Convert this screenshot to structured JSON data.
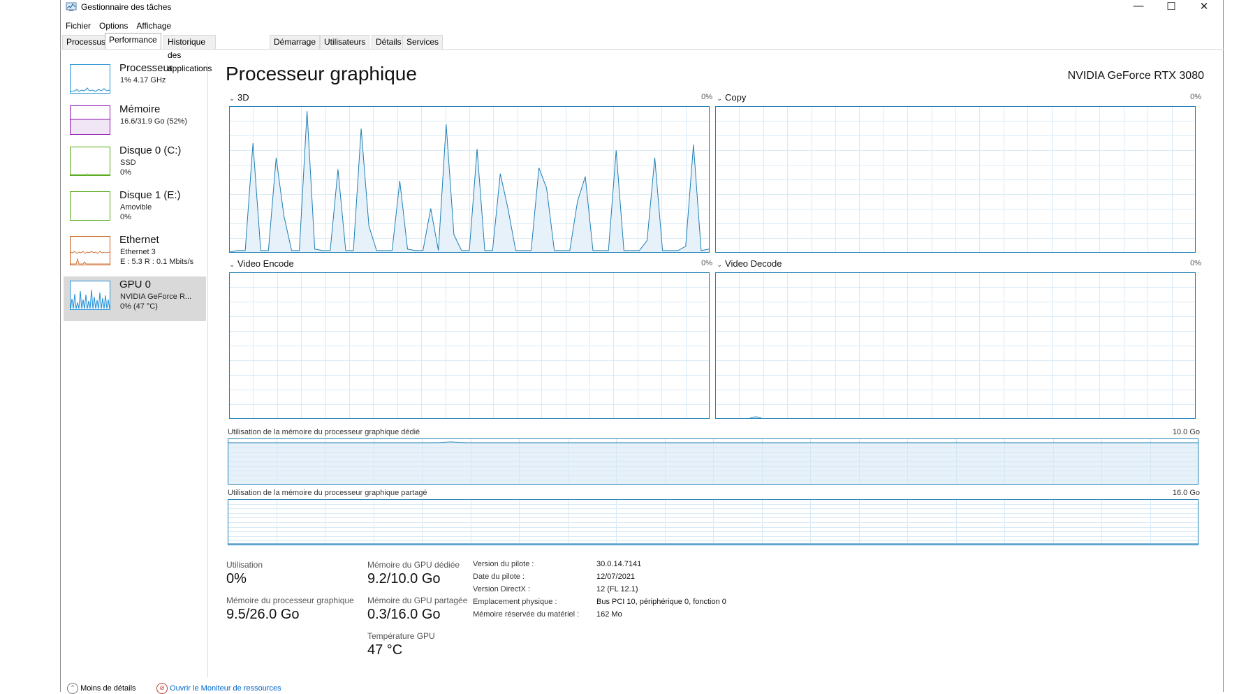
{
  "window": {
    "title": "Gestionnaire des tâches"
  },
  "window_controls": {
    "minimize": "—",
    "maximize": "☐",
    "close": "✕"
  },
  "menu": [
    "Fichier",
    "Options",
    "Affichage"
  ],
  "tabs": [
    "Processus",
    "Performance",
    "Historique des applications",
    "Démarrage",
    "Utilisateurs",
    "Détails",
    "Services"
  ],
  "active_tab": "Performance",
  "sidebar": {
    "items": [
      {
        "name": "Processeur",
        "lines": [
          "1% 4.17 GHz"
        ],
        "color": "#1f8fd6",
        "selected": false
      },
      {
        "name": "Mémoire",
        "lines": [
          "16.6/31.9 Go (52%)"
        ],
        "color": "#8b12ae",
        "selected": false
      },
      {
        "name": "Disque 0 (C:)",
        "lines": [
          "SSD",
          "0%"
        ],
        "color": "#4da60c",
        "selected": false
      },
      {
        "name": "Disque 1 (E:)",
        "lines": [
          "Amovible",
          "0%"
        ],
        "color": "#4da60c",
        "selected": false
      },
      {
        "name": "Ethernet",
        "lines": [
          "Ethernet 3",
          "E : 5.3 R : 0.1 Mbits/s"
        ],
        "color": "#c6570f",
        "selected": false
      },
      {
        "name": "GPU 0",
        "lines": [
          "NVIDIA GeForce R...",
          "0% (47 °C)"
        ],
        "color": "#1f8fd6",
        "selected": true
      }
    ]
  },
  "main": {
    "title": "Processeur graphique",
    "gpu_model": "NVIDIA GeForce RTX 3080",
    "engines": [
      {
        "label": "3D",
        "percent": "0%"
      },
      {
        "label": "Copy",
        "percent": "0%"
      },
      {
        "label": "Video Encode",
        "percent": "0%"
      },
      {
        "label": "Video Decode",
        "percent": "0%"
      }
    ],
    "dedicated_memory": {
      "label": "Utilisation de la mémoire du processeur graphique dédié",
      "max": "10.0 Go"
    },
    "shared_memory": {
      "label": "Utilisation de la mémoire du processeur graphique partagé",
      "max": "16.0 Go"
    }
  },
  "stats": {
    "utilisation": {
      "label": "Utilisation",
      "value": "0%"
    },
    "gpu_memory": {
      "label": "Mémoire du processeur graphique",
      "value": "9.5/26.0 Go"
    },
    "dedicated": {
      "label": "Mémoire du GPU dédiée",
      "value": "9.2/10.0 Go"
    },
    "shared": {
      "label": "Mémoire du GPU partagée",
      "value": "0.3/16.0 Go"
    },
    "temperature": {
      "label": "Température GPU",
      "value": "47 °C"
    }
  },
  "details": [
    {
      "key": "Version du pilote :",
      "value": "30.0.14.7141"
    },
    {
      "key": "Date du pilote :",
      "value": "12/07/2021"
    },
    {
      "key": "Version DirectX :",
      "value": "12 (FL 12.1)"
    },
    {
      "key": "Emplacement physique :",
      "value": "Bus PCI 10, périphérique 0, fonction 0"
    },
    {
      "key": "Mémoire réservée du matériel :",
      "value": "162 Mo"
    }
  ],
  "footer": {
    "less_details": "Moins de détails",
    "resource_monitor": "Ouvrir le Moniteur de ressources"
  },
  "graph_3d_series": [
    0,
    1,
    1,
    75,
    1,
    1,
    65,
    25,
    1,
    1,
    97,
    2,
    1,
    1,
    57,
    1,
    1,
    85,
    18,
    1,
    1,
    1,
    49,
    2,
    1,
    1,
    30,
    1,
    88,
    12,
    1,
    1,
    71,
    1,
    1,
    54,
    30,
    1,
    1,
    1,
    58,
    44,
    1,
    1,
    1,
    35,
    52,
    1,
    1,
    1,
    70,
    1,
    1,
    1,
    8,
    65,
    1,
    1,
    1,
    4,
    74,
    1,
    2
  ]
}
